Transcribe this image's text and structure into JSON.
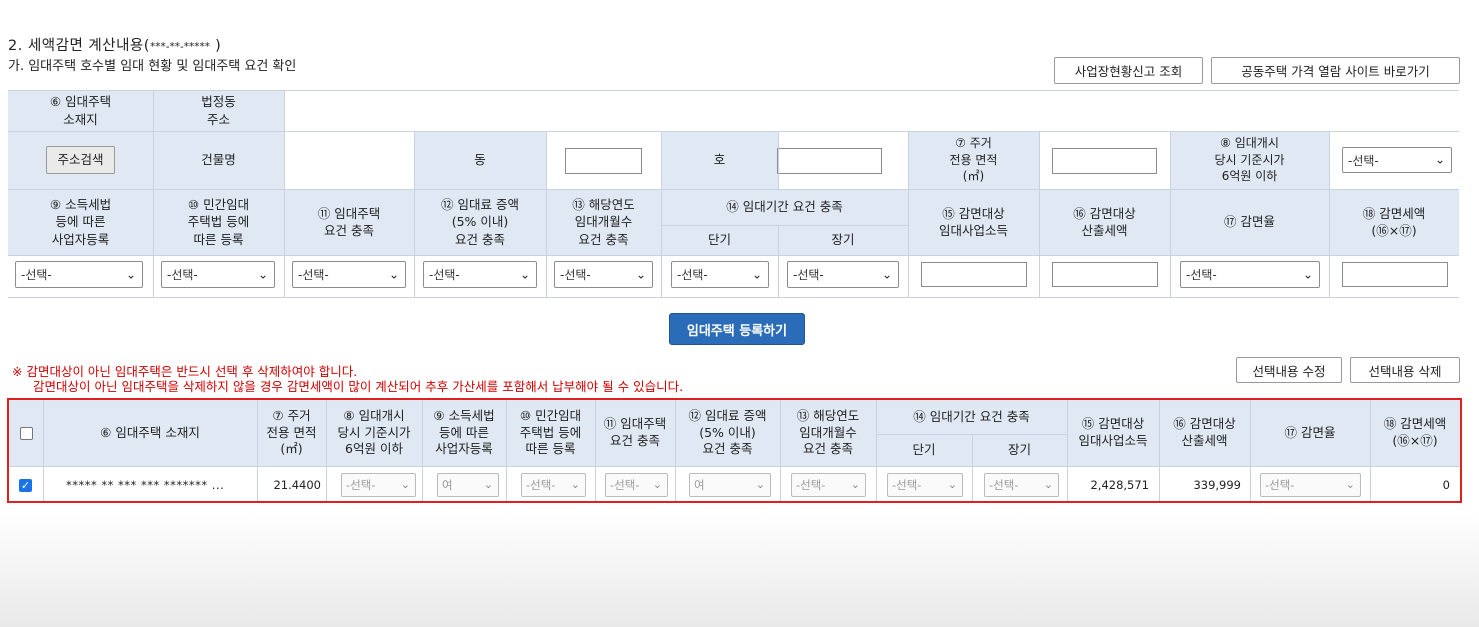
{
  "section_title": "2. 세액감면 계산내용(",
  "section_mask": "***-**-*****",
  "section_close": ")",
  "sub_title": "가. 임대주택 호수별 임대 현황 및 임대주택 요건 확인",
  "buttons": {
    "biz_lookup": "사업장현황신고 조회",
    "price_site": "공동주택 가격 열람 사이트 바로가기",
    "addr_search": "주소검색",
    "register": "임대주택 등록하기",
    "edit_selected": "선택내용 수정",
    "delete_selected": "선택내용 삭제"
  },
  "form": {
    "location_label": "⑥ 임대주택\n소재지",
    "legal_dong_label": "법정동\n주소",
    "building_label": "건물명",
    "dong_label": "동",
    "ho_label": "호",
    "area_label": "⑦ 주거\n전용 면적\n(㎡)",
    "price_label": "⑧ 임대개시\n당시 기준시가\n6억원 이하",
    "h9": "⑨ 소득세법\n등에 따른\n사업자등록",
    "h10": "⑩ 민간임대\n주택법 등에\n따른 등록",
    "h11": "⑪ 임대주택\n요건 충족",
    "h12": "⑫ 임대료 증액\n(5% 이내)\n요건 충족",
    "h13": "⑬ 해당연도\n임대개월수\n요건 충족",
    "h14": "⑭ 임대기간 요건 충족",
    "h14_short": "단기",
    "h14_long": "장기",
    "h15": "⑮ 감면대상\n임대사업소득",
    "h16": "⑯ 감면대상\n산출세액",
    "h17": "⑰ 감면율",
    "h18": "⑱ 감면세액\n(⑯×⑰)",
    "select_default": "-선택-"
  },
  "warning": {
    "line1": "※ 감면대상이 아닌 임대주택은 반드시 선택 후 삭제하여야 합니다.",
    "line2": "감면대상이 아닌 임대주택을 삭제하지 않을 경우 감면세액이 많이 계산되어 추후 가산세를 포함해서 납부해야 될 수 있습니다."
  },
  "table": {
    "headers": {
      "location": "⑥ 임대주택 소재지",
      "area": "⑦ 주거\n전용 면적\n(㎡)",
      "price": "⑧ 임대개시\n당시 기준시가\n6억원 이하",
      "h9": "⑨ 소득세법\n등에 따른\n사업자등록",
      "h10": "⑩ 민간임대\n주택법 등에\n따른 등록",
      "h11": "⑪ 임대주택\n요건 충족",
      "h12": "⑫ 임대료 증액\n(5% 이내)\n요건 충족",
      "h13": "⑬ 해당연도\n임대개월수\n요건 충족",
      "h14": "⑭ 임대기간 요건 충족",
      "short": "단기",
      "long": "장기",
      "h15": "⑮ 감면대상\n임대사업소득",
      "h16": "⑯ 감면대상\n산출세액",
      "h17": "⑰ 감면율",
      "h18": "⑱ 감면세액\n(⑯×⑰)"
    },
    "row": {
      "checked": true,
      "address": "***** ** *** *** ******* ...",
      "area": "21.4400",
      "price": "-선택-",
      "h9": "여",
      "h10": "-선택-",
      "h11": "-선택-",
      "h12": "여",
      "h13": "-선택-",
      "short": "-선택-",
      "long": "-선택-",
      "income": "2,428,571",
      "tax": "339,999",
      "rate": "-선택-",
      "reduction": "0"
    }
  }
}
